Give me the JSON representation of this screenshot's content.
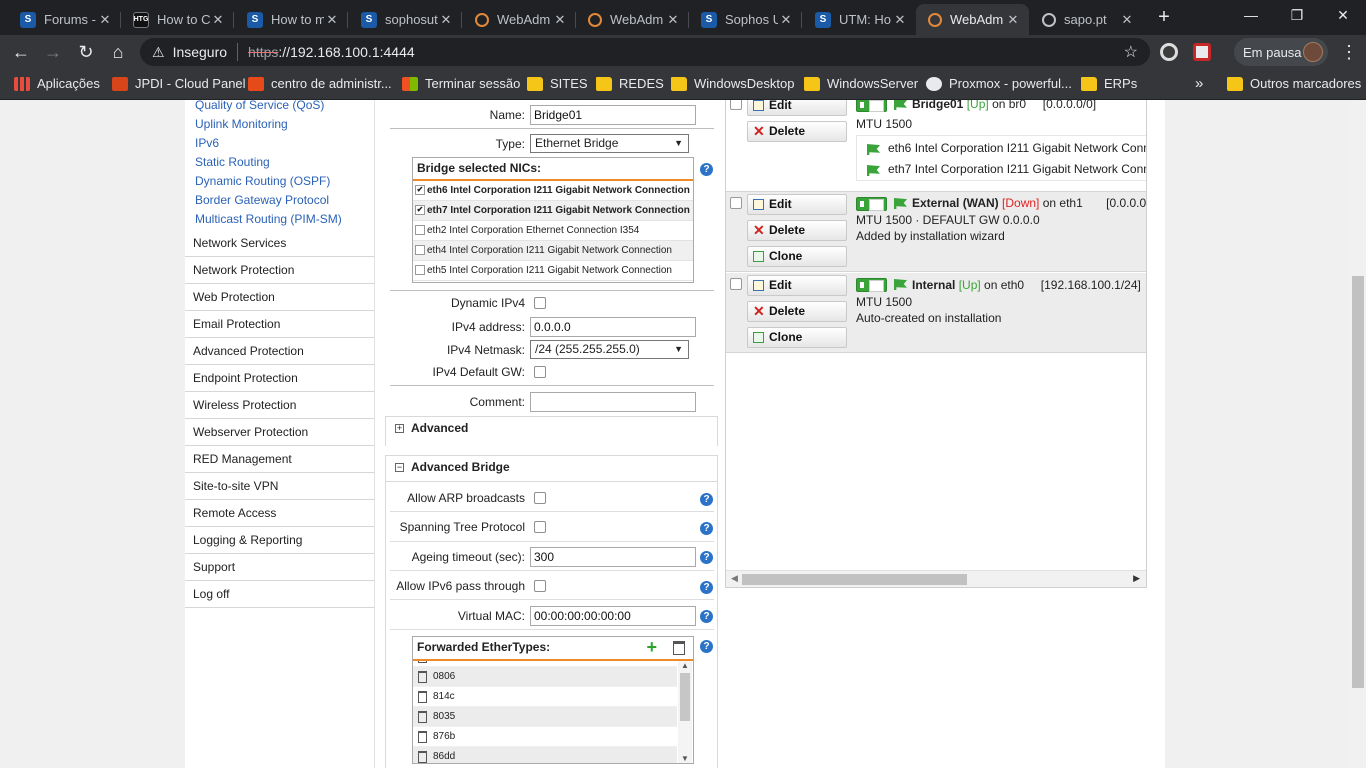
{
  "browser": {
    "tabs": [
      {
        "title": "Forums -",
        "icon": "sophos-s-icon"
      },
      {
        "title": "How to C",
        "icon": "htg-icon"
      },
      {
        "title": "How to m",
        "icon": "sophos-s-icon"
      },
      {
        "title": "sophosut",
        "icon": "sophos-s-icon"
      },
      {
        "title": "WebAdm",
        "icon": "webadmin-icon"
      },
      {
        "title": "WebAdm",
        "icon": "webadmin-icon"
      },
      {
        "title": "Sophos U",
        "icon": "sophos-s-icon"
      },
      {
        "title": "UTM: Ho",
        "icon": "sophos-s-icon"
      },
      {
        "title": "WebAdm",
        "icon": "webadmin-icon"
      },
      {
        "title": "sapo.pt",
        "icon": "globe-icon"
      }
    ],
    "address": {
      "security_label": "Inseguro",
      "protocol": "https",
      "host": "://192.168.100.1:4444"
    },
    "profile_label": "Em pausa",
    "bookmarks": [
      {
        "label": "Aplicações",
        "icon": "apps-icon"
      },
      {
        "label": "JPDI - Cloud Panel",
        "icon": "jpdi-icon"
      },
      {
        "label": "centro de administr...",
        "icon": "office-icon"
      },
      {
        "label": "Terminar sessão",
        "icon": "microsoft-icon"
      },
      {
        "label": "SITES",
        "icon": "folder-icon"
      },
      {
        "label": "REDES",
        "icon": "folder-icon"
      },
      {
        "label": "WindowsDesktop",
        "icon": "folder-icon"
      },
      {
        "label": "WindowsServer",
        "icon": "folder-icon"
      },
      {
        "label": "Proxmox - powerful...",
        "icon": "proxmox-icon"
      },
      {
        "label": "ERPs",
        "icon": "folder-icon"
      }
    ],
    "other_bookmarks": "Outros marcadores"
  },
  "sidebar": {
    "subitems": [
      "Quality of Service (QoS)",
      "Uplink Monitoring",
      "IPv6",
      "Static Routing",
      "Dynamic Routing (OSPF)",
      "Border Gateway Protocol",
      "Multicast Routing (PIM-SM)"
    ],
    "items": [
      "Network Services",
      "Network Protection",
      "Web Protection",
      "Email Protection",
      "Advanced Protection",
      "Endpoint Protection",
      "Wireless Protection",
      "Webserver Protection",
      "RED Management",
      "Site-to-site VPN",
      "Remote Access",
      "Logging & Reporting",
      "Support",
      "Log off"
    ]
  },
  "form": {
    "name_label": "Name:",
    "name_value": "Bridge01",
    "type_label": "Type:",
    "type_value": "Ethernet Bridge",
    "nics_header": "Bridge selected NICs:",
    "nics": [
      {
        "label": "eth6 Intel Corporation I211 Gigabit Network Connection",
        "checked": true
      },
      {
        "label": "eth7 Intel Corporation I211 Gigabit Network Connection",
        "checked": true
      },
      {
        "label": "eth2 Intel Corporation Ethernet Connection I354",
        "checked": false
      },
      {
        "label": "eth4 Intel Corporation I211 Gigabit Network Connection",
        "checked": false
      },
      {
        "label": "eth5 Intel Corporation I211 Gigabit Network Connection",
        "checked": false
      }
    ],
    "dynamic_ipv4_label": "Dynamic IPv4",
    "ipv4_address_label": "IPv4 address:",
    "ipv4_address_value": "0.0.0.0",
    "ipv4_netmask_label": "IPv4 Netmask:",
    "ipv4_netmask_value": "/24 (255.255.255.0)",
    "ipv4_gw_label": "IPv4 Default GW:",
    "comment_label": "Comment:",
    "comment_value": "",
    "advanced_title": "Advanced",
    "advanced_bridge_title": "Advanced Bridge",
    "allow_arp_label": "Allow ARP broadcasts",
    "stp_label": "Spanning Tree Protocol",
    "ageing_label": "Ageing timeout (sec):",
    "ageing_value": "300",
    "ipv6_pass_label": "Allow IPv6 pass through",
    "vmac_label": "Virtual MAC:",
    "vmac_value": "00:00:00:00:00:00",
    "ethertypes_header": "Forwarded EtherTypes:",
    "ethertypes": [
      "0806",
      "814c",
      "8035",
      "876b",
      "86dd"
    ]
  },
  "interfaces": [
    {
      "name": "Bridge01",
      "status": "[Up]",
      "on": "on br0",
      "addr": "[0.0.0.0/0]",
      "lines": [
        "MTU 1500"
      ],
      "members": [
        "eth6 Intel Corporation I211 Gigabit Network Conn",
        "eth7 Intel Corporation I211 Gigabit Network Conn"
      ],
      "buttons": [
        "Edit",
        "Delete"
      ]
    },
    {
      "name": "External (WAN)",
      "status": "[Down]",
      "on": "on eth1",
      "addr": "[0.0.0.0/",
      "lines": [
        "MTU 1500 · DEFAULT GW 0.0.0.0",
        "Added by installation wizard"
      ],
      "buttons": [
        "Edit",
        "Delete",
        "Clone"
      ]
    },
    {
      "name": "Internal",
      "status": "[Up]",
      "on": "on eth0",
      "addr": "[192.168.100.1/24]",
      "lines": [
        "MTU 1500",
        "Auto-created on installation"
      ],
      "buttons": [
        "Edit",
        "Delete",
        "Clone"
      ]
    }
  ],
  "colors": {
    "accent_orange": "#f08a24",
    "status_up": "#3aa43a",
    "status_down": "#dd2222",
    "link_blue": "#2b62b6"
  }
}
